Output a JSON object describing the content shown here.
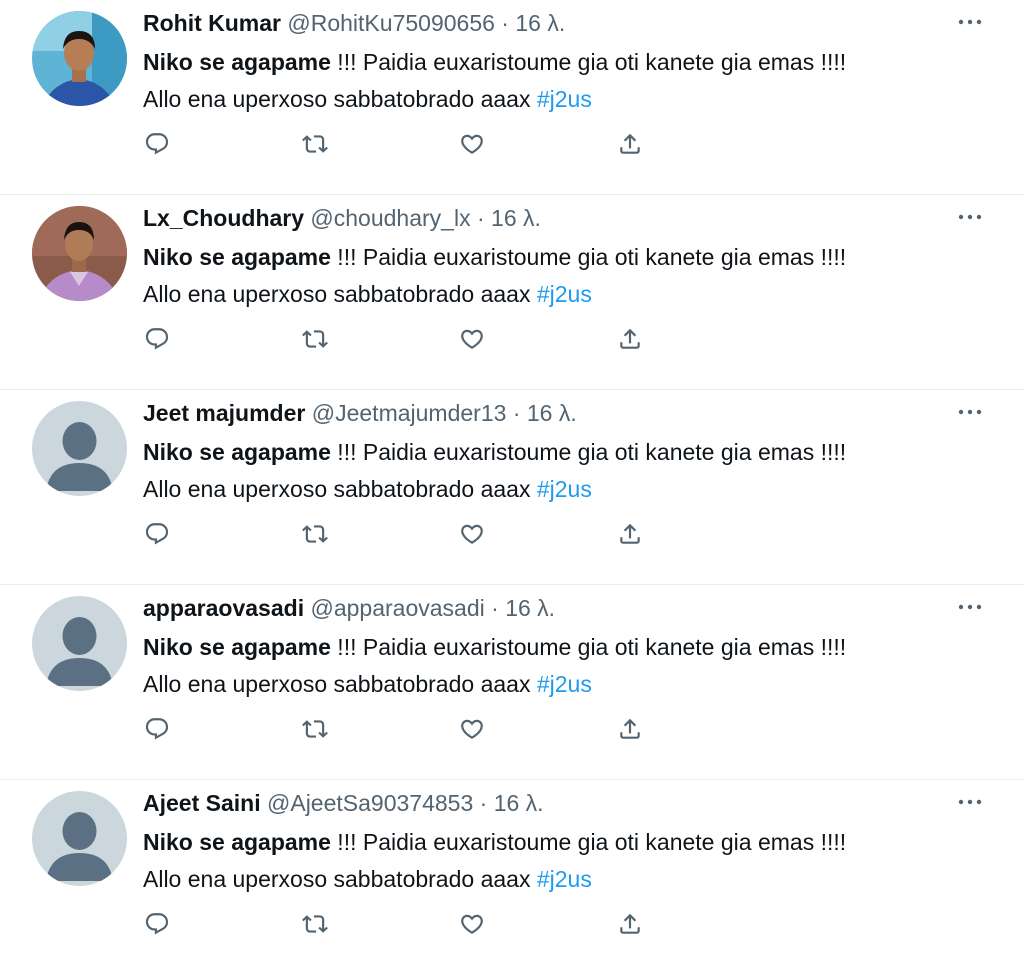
{
  "colors": {
    "text": "#0f1419",
    "secondary": "#536471",
    "link": "#1d9bf0",
    "divider": "#e6ecf0",
    "default_avatar_bg": "#ccd6dd",
    "default_avatar_fg": "#5b7083"
  },
  "tweets": [
    {
      "name": "Rohit Kumar",
      "handle": "@RohitKu75090656",
      "separator": "·",
      "time": "16 λ.",
      "avatar": "photo-avatar",
      "text_bold": "Niko se agapame",
      "text_rest": " !!! Paidia euxaristoume gia oti kanete gia emas !!!!",
      "text_line2": "Allo ena uperxoso sabbatobrado aaax ",
      "hashtag": "#j2us"
    },
    {
      "name": "Lx_Choudhary",
      "handle": "@choudhary_lx",
      "separator": "·",
      "time": "16 λ.",
      "avatar": "photo-avatar",
      "text_bold": "Niko se agapame",
      "text_rest": " !!! Paidia euxaristoume gia oti kanete gia emas !!!!",
      "text_line2": "Allo ena uperxoso sabbatobrado aaax ",
      "hashtag": "#j2us"
    },
    {
      "name": "Jeet majumder",
      "handle": "@Jeetmajumder13",
      "separator": "·",
      "time": "16 λ.",
      "avatar": "default-avatar",
      "text_bold": "Niko se agapame",
      "text_rest": " !!! Paidia euxaristoume gia oti kanete gia emas !!!!",
      "text_line2": "Allo ena uperxoso sabbatobrado aaax ",
      "hashtag": "#j2us"
    },
    {
      "name": "apparaovasadi",
      "handle": "@apparaovasadi",
      "separator": "·",
      "time": "16 λ.",
      "avatar": "default-avatar",
      "text_bold": "Niko se agapame",
      "text_rest": " !!! Paidia euxaristoume gia oti kanete gia emas !!!!",
      "text_line2": "Allo ena uperxoso sabbatobrado aaax ",
      "hashtag": "#j2us"
    },
    {
      "name": "Ajeet Saini",
      "handle": "@AjeetSa90374853",
      "separator": "·",
      "time": "16 λ.",
      "avatar": "default-avatar",
      "text_bold": "Niko se agapame",
      "text_rest": " !!! Paidia euxaristoume gia oti kanete gia emas !!!!",
      "text_line2": "Allo ena uperxoso sabbatobrado aaax ",
      "hashtag": "#j2us"
    }
  ],
  "icons": {
    "more": "more-icon",
    "reply": "reply-icon",
    "retweet": "retweet-icon",
    "like": "like-icon",
    "share": "share-icon"
  }
}
